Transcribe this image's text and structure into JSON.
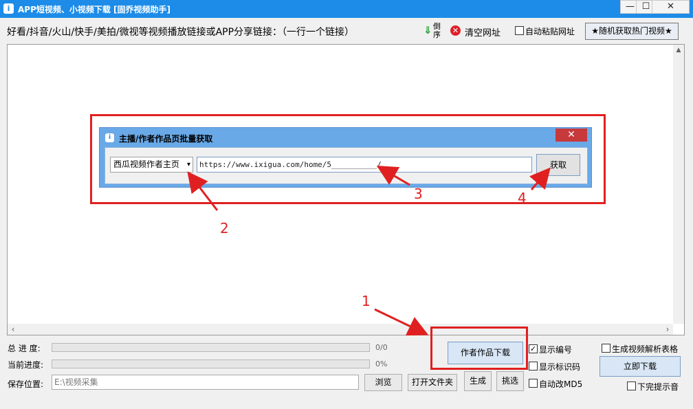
{
  "window": {
    "title": "APP短视频、小视频下载 [固乔视频助手]",
    "icon": "app-icon",
    "minimize": "—",
    "maximize": "☐",
    "close": "✕"
  },
  "toolbar": {
    "label": "好看/抖音/火山/快手/美拍/微视等视频播放链接或APP分享链接：（一行一个链接）",
    "reverse_label": "倒序",
    "reverse_arrow": "⇓",
    "clear_label": "清空网址",
    "clear_icon": "✕",
    "auto_paste_label": "自动粘贴网址",
    "hot_button_label": "★随机获取热门视频★"
  },
  "dialog": {
    "title": "主播/作者作品页批量获取",
    "close_glyph": "✕",
    "source_select": "西瓜视频作者主页",
    "url_value": "https://www.ixigua.com/home/5__________/",
    "fetch_label": "获取"
  },
  "annotations": {
    "one": "1",
    "two": "2",
    "three": "3",
    "four": "4",
    "color": "#e02020"
  },
  "bottom": {
    "total_progress_label": "总 进 度:",
    "total_progress_text": "0/0",
    "current_progress_label": "当前进度:",
    "current_progress_text": "0%",
    "save_label": "保存位置:",
    "save_path": "E:\\视频采集",
    "browse_label": "浏览",
    "open_folder_label": "打开文件夹",
    "generate_label": "生成",
    "pick_label": "挑选",
    "author_download_label": "作者作品下载",
    "show_number_label": "显示编号",
    "show_number_checked": true,
    "show_id_label": "显示标识码",
    "auto_md5_label": "自动改MD5",
    "gen_table_label": "生成视频解析表格",
    "download_now_label": "立即下载",
    "done_sound_label": "下完提示音"
  },
  "checkmark": "✓"
}
